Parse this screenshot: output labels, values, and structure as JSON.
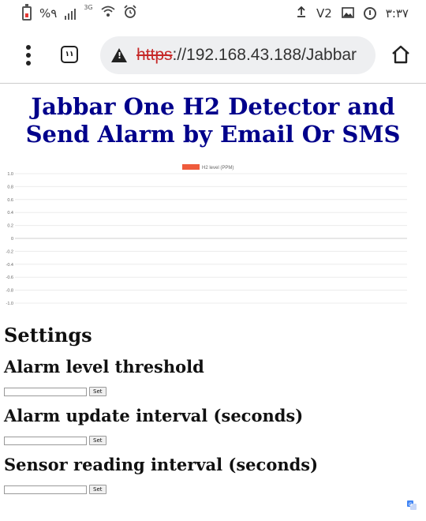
{
  "statusbar": {
    "battery_percent": "%٩",
    "network": "3G",
    "right_indicator": "V2",
    "clock": "٣:٣٧"
  },
  "browser": {
    "tab_count": "١١",
    "url_scheme": "https",
    "url_rest": "://192.168.43.188/Jabbar",
    "warning_color": "#222222",
    "scheme_color": "#c62828"
  },
  "page": {
    "title": "Jabbar One H2 Detector and Send Alarm by Email Or SMS",
    "title_color": "#00008b"
  },
  "chart_data": {
    "type": "line",
    "series": [
      {
        "name": "H2 level (PPM)",
        "color": "#ef5b3c",
        "values": []
      }
    ],
    "x": [],
    "ylim": [
      -1.0,
      1.0
    ],
    "yticks": [
      "1.0",
      "0.8",
      "0.6",
      "0.4",
      "0.2",
      "0",
      "-0.2",
      "-0.4",
      "-0.6",
      "-0.8",
      "-1.0"
    ],
    "grid": true,
    "legend": "top-center"
  },
  "settings": {
    "heading": "Settings",
    "fields": [
      {
        "label": "Alarm level threshold",
        "value": "",
        "button": "Set"
      },
      {
        "label": "Alarm update interval (seconds)",
        "value": "",
        "button": "Set"
      },
      {
        "label": "Sensor reading interval (seconds)",
        "value": "",
        "button": "Set"
      }
    ]
  }
}
